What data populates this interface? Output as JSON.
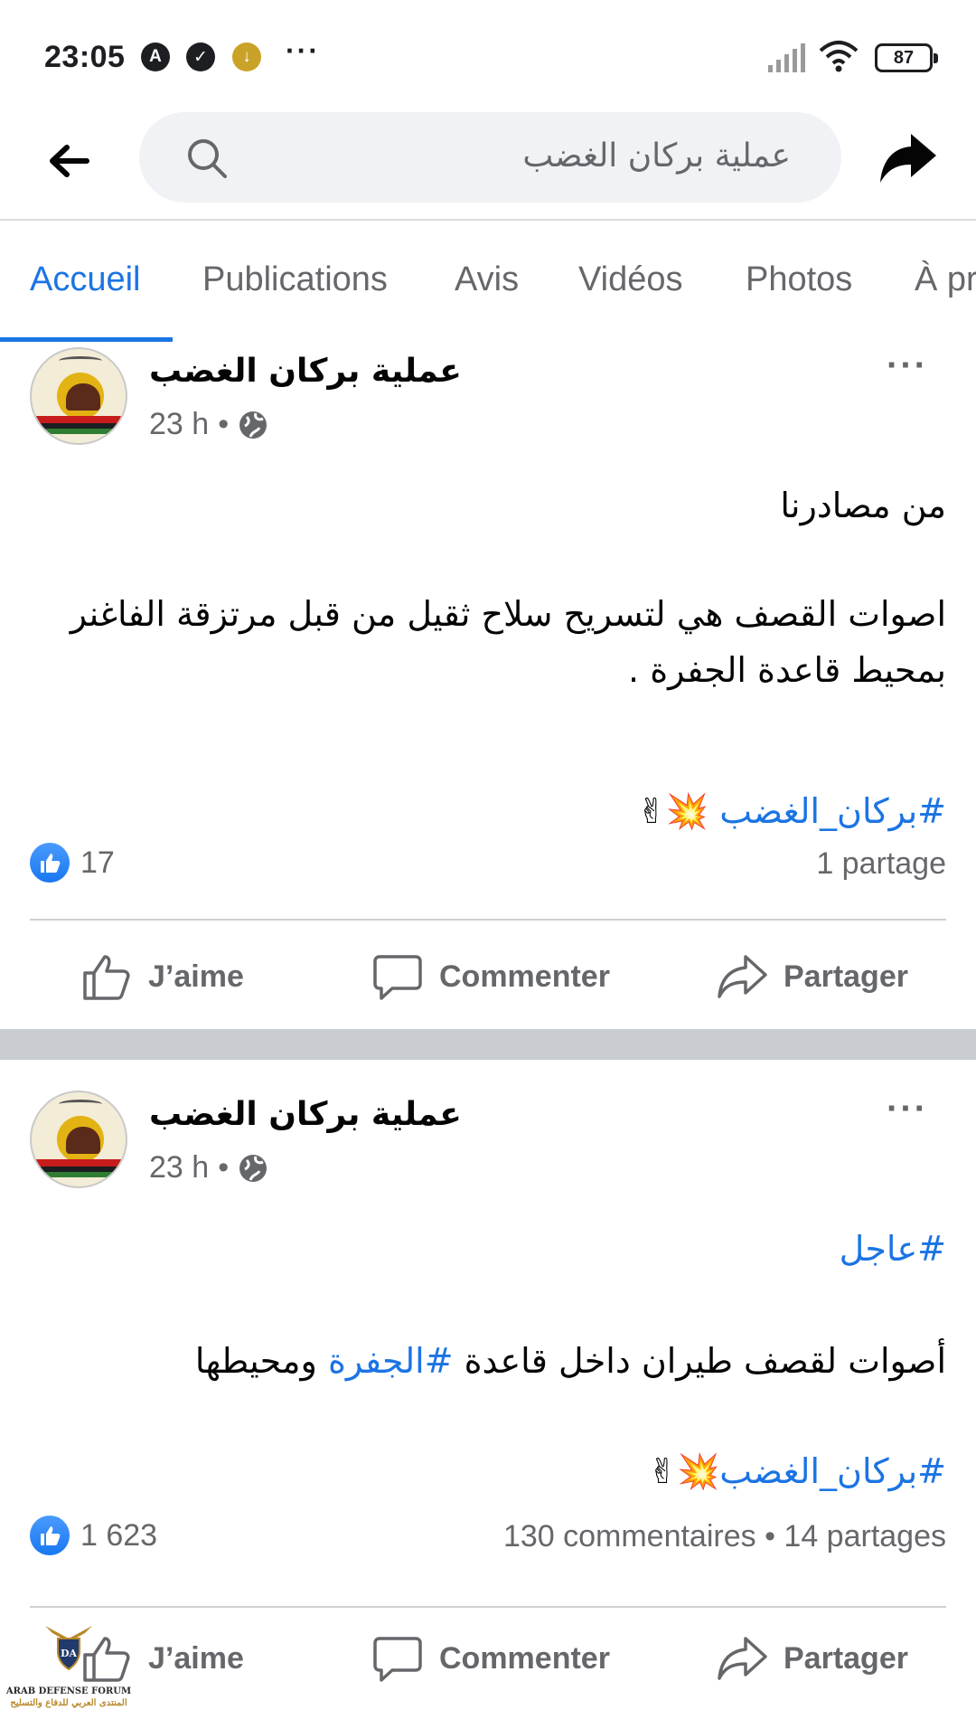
{
  "status_bar": {
    "time": "23:05",
    "battery": "87"
  },
  "header": {
    "search_query": "عملية بركان الغضب"
  },
  "tabs": [
    {
      "label": "Accueil",
      "active": true
    },
    {
      "label": "Publications",
      "active": false
    },
    {
      "label": "Avis",
      "active": false
    },
    {
      "label": "Vidéos",
      "active": false
    },
    {
      "label": "Photos",
      "active": false
    },
    {
      "label": "À pr",
      "active": false
    }
  ],
  "posts": [
    {
      "page_name": "عملية بركان الغضب",
      "time": "23 h",
      "para1": "من مصادرنا",
      "para2": "اصوات القصف هي لتسريح سلاح ثقيل من قبل مرتزقة الفاغنر بمحيط قاعدة الجفرة .",
      "hashtag": "#بركان_الغضب",
      "emojis": "💥✌",
      "likes": "17",
      "shares": "1 partage"
    },
    {
      "page_name": "عملية بركان الغضب",
      "time": "23 h",
      "hashtag_top": "#عاجل",
      "para_prefix": "أصوات لقصف طيران داخل قاعدة ",
      "para_hashtag": "#الجفرة",
      "para_suffix": " ومحيطها",
      "hashtag": "#بركان_الغضب",
      "emojis": "💥✌",
      "likes": "1 623",
      "shares": "130 commentaires • 14 partages"
    }
  ],
  "actions": {
    "like": "J’aime",
    "comment": "Commenter",
    "share": "Partager"
  },
  "watermark": {
    "line1": "ARAB DEFENSE FORUM",
    "line2": "المنتدى العربي للدفاع والتسليح"
  },
  "colors": {
    "accent": "#1b74e4",
    "secondary_text": "#65676b",
    "search_bg": "#f0f2f5",
    "separator": "#c9ccd1"
  }
}
